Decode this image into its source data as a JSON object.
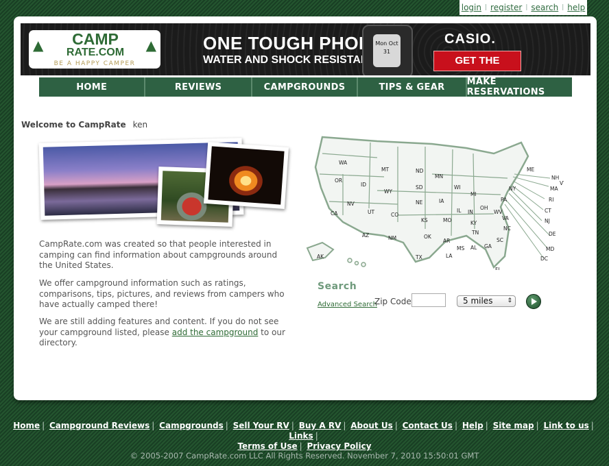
{
  "top_links": [
    "login",
    "register",
    "search",
    "help"
  ],
  "banner": {
    "logo_line1": "CAMP",
    "logo_line2": "RATE.COM",
    "logo_tagline": "BE A HAPPY CAMPER",
    "ad_headline": "ONE TOUGH PHONE",
    "ad_subline": "WATER AND SHOCK RESISTANT",
    "phone_screen": "Mon Oct 31",
    "ad_brand": "CASIO.",
    "ad_cta": "GET THE DETAILS"
  },
  "main_nav": [
    "HOME",
    "REVIEWS",
    "CAMPGROUNDS",
    "TIPS & GEAR",
    "MAKE RESERVATIONS"
  ],
  "welcome": {
    "label": "Welcome to CampRate",
    "user": "ken"
  },
  "intro": {
    "p1": "CampRate.com was created so that people interested in camping can find information about campgrounds around the United States.",
    "p2": "We offer campground information such as ratings, comparisons, tips, pictures, and reviews from campers who have actually camped there!",
    "p3_before": "We are still adding features and content. If you do not see your campground listed, please ",
    "p3_link": "add the campground",
    "p3_after": " to our directory."
  },
  "map_states": [
    "WA",
    "OR",
    "CA",
    "ID",
    "NV",
    "MT",
    "WY",
    "UT",
    "AZ",
    "CO",
    "NM",
    "ND",
    "SD",
    "NE",
    "KS",
    "OK",
    "TX",
    "MN",
    "IA",
    "MO",
    "AR",
    "LA",
    "WI",
    "IL",
    "MS",
    "MI",
    "IN",
    "KY",
    "TN",
    "AL",
    "OH",
    "GA",
    "FL",
    "WV",
    "VA",
    "NC",
    "SC",
    "PA",
    "NY",
    "ME",
    "NH",
    "VT",
    "MA",
    "RI",
    "CT",
    "NJ",
    "DE",
    "MD",
    "DC",
    "AK",
    "HI"
  ],
  "search": {
    "title": "Search",
    "advanced_link": "Advanced Search",
    "zip_label": "Zip Code:",
    "zip_value": "",
    "distance_selected": "5 miles"
  },
  "footer": {
    "links_row1": [
      "Home",
      "Campground Reviews",
      "Campgrounds",
      "Sell Your RV",
      "Buy A RV",
      "About Us",
      "Contact Us",
      "Help",
      "Site map",
      "Link to us",
      "Links"
    ],
    "links_row2": [
      "Terms of Use",
      "Privacy Policy"
    ],
    "copyright": "© 2005-2007 CampRate.com LLC All Rights Reserved. November 7, 2010 15:50:01 GMT"
  },
  "colors": {
    "nav_green": "#2e6143",
    "page_green": "#1d4a2a",
    "cta_red": "#c8101c"
  }
}
